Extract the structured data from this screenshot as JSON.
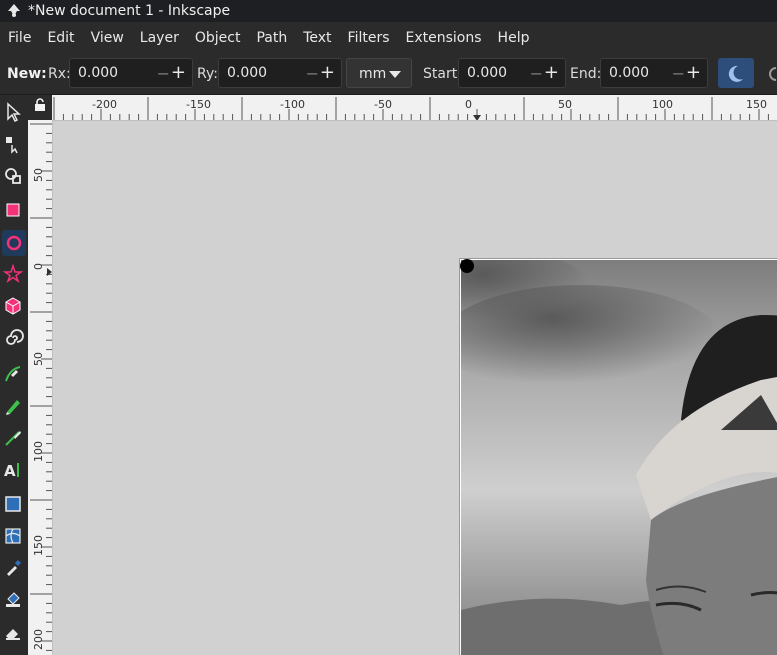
{
  "window": {
    "title": "*New document 1 - Inkscape"
  },
  "menu": [
    "File",
    "Edit",
    "View",
    "Layer",
    "Object",
    "Path",
    "Text",
    "Filters",
    "Extensions",
    "Help"
  ],
  "toolbar": {
    "new_label": "New:",
    "rx_label": "Rx:",
    "rx_value": "0.000",
    "ry_label": "Ry:",
    "ry_value": "0.000",
    "unit": "mm",
    "start_label": "Start:",
    "start_value": "0.000",
    "end_label": "End:",
    "end_value": "0.000"
  },
  "ruler_h": [
    "-200",
    "-150",
    "-100",
    "-50",
    "0",
    "50",
    "100",
    "150"
  ],
  "ruler_v": [
    "50",
    "0",
    "50",
    "100",
    "150",
    "200"
  ],
  "tools": [
    "selector-tool-icon",
    "node-tool-icon",
    "tweak-tool-icon",
    "rectangle-tool-icon",
    "ellipse-tool-icon",
    "star-tool-icon",
    "3d-box-tool-icon",
    "spiral-tool-icon",
    "pen-tool-icon",
    "pencil-tool-icon",
    "calligraphy-tool-icon",
    "text-tool-icon",
    "gradient-tool-icon",
    "mesh-tool-icon",
    "dropper-tool-icon",
    "paint-bucket-tool-icon",
    "eraser-tool-icon"
  ],
  "colors": {
    "accent": "#2d4d7a",
    "canvas": "#d1d1d1",
    "chrome": "#2b2b2b"
  }
}
